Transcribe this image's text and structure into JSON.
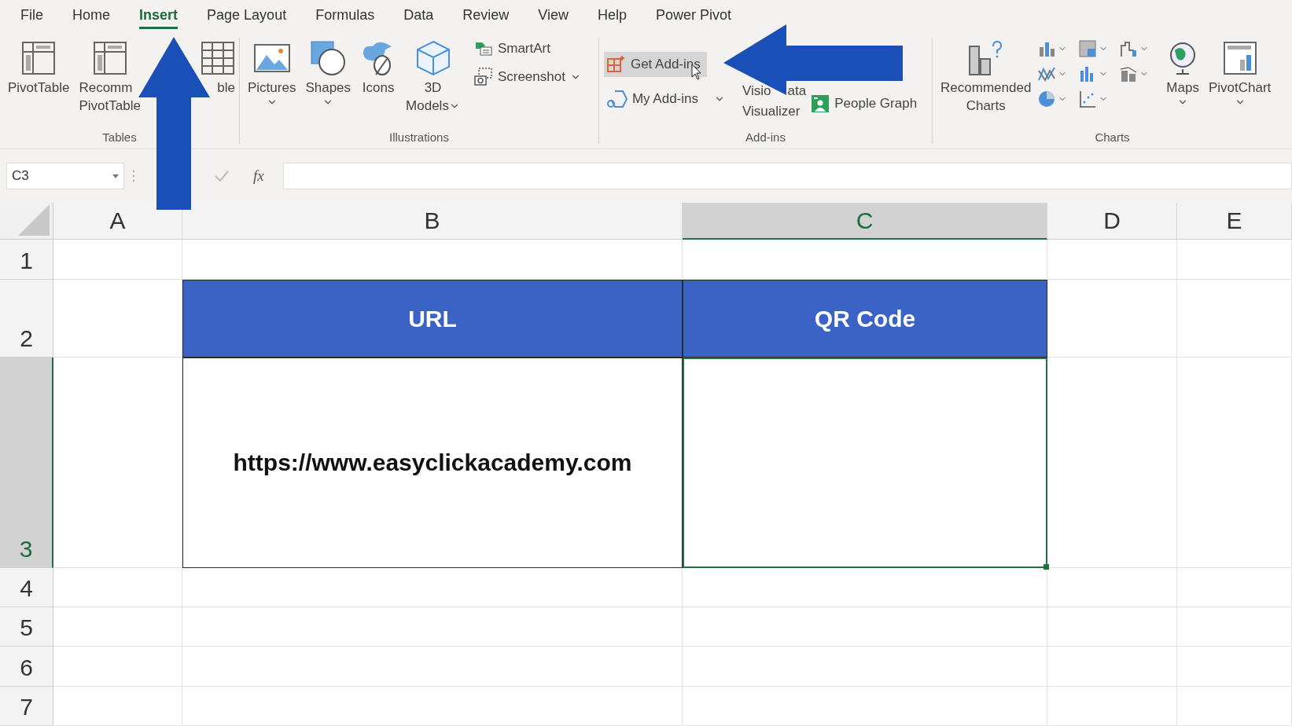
{
  "tabs": [
    {
      "label": "File",
      "selected": false
    },
    {
      "label": "Home",
      "selected": false
    },
    {
      "label": "Insert",
      "selected": true
    },
    {
      "label": "Page Layout",
      "selected": false
    },
    {
      "label": "Formulas",
      "selected": false
    },
    {
      "label": "Data",
      "selected": false
    },
    {
      "label": "Review",
      "selected": false
    },
    {
      "label": "View",
      "selected": false
    },
    {
      "label": "Help",
      "selected": false
    },
    {
      "label": "Power Pivot",
      "selected": false
    }
  ],
  "ribbon": {
    "tables": {
      "label": "Tables",
      "pivot_table": "PivotTable",
      "recommended_lines": [
        "Recomm",
        "PivotTable"
      ],
      "table": "ble"
    },
    "illustrations": {
      "label": "Illustrations",
      "pictures": "Pictures",
      "shapes": "Shapes",
      "icons": "Icons",
      "models_lines": [
        "3D",
        "Models"
      ],
      "smartart": "SmartArt",
      "screenshot": "Screenshot"
    },
    "addins": {
      "label": "Add-ins",
      "get": "Get Add-ins",
      "my": "My Add-ins",
      "visio_parts": [
        "Visio",
        "ata"
      ],
      "visio_line2": "Visualizer",
      "people": "People Graph"
    },
    "charts": {
      "label": "Charts",
      "recommended_lines": [
        "Recommended",
        "Charts"
      ],
      "maps": "Maps",
      "pivot_chart": "PivotChart"
    }
  },
  "formula_bar": {
    "name_box": "C3",
    "fx": "fx"
  },
  "sheet": {
    "columns": [
      {
        "label": "A",
        "selected": false
      },
      {
        "label": "B",
        "selected": false
      },
      {
        "label": "C",
        "selected": true
      },
      {
        "label": "D",
        "selected": false
      },
      {
        "label": "E",
        "selected": false
      }
    ],
    "rows": [
      {
        "label": "1",
        "selected": false
      },
      {
        "label": "2",
        "selected": false
      },
      {
        "label": "3",
        "selected": true
      },
      {
        "label": "4",
        "selected": false
      },
      {
        "label": "5",
        "selected": false
      },
      {
        "label": "6",
        "selected": false
      },
      {
        "label": "7",
        "selected": false
      }
    ],
    "table": [
      {
        "heading": "URL",
        "value": "https://www.easyclickacademy.com"
      },
      {
        "heading": "QR Code"
      }
    ]
  }
}
